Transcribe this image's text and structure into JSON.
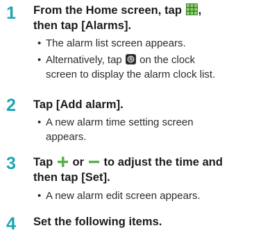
{
  "steps": [
    {
      "number": "1",
      "title_part1": "From the Home screen, tap",
      "title_part2": ",",
      "title_line2": "then tap [Alarms].",
      "title_icon": "app-grid-icon",
      "bullets": [
        {
          "dot": "•",
          "text": "The alarm list screen appears."
        },
        {
          "dot": "•",
          "text_part1": "Alternatively, tap",
          "text_part2": "on the clock",
          "text_line2": "screen to display the alarm clock list.",
          "icon": "alarm-clock-icon"
        }
      ]
    },
    {
      "number": "2",
      "title": "Tap [Add alarm].",
      "bullets": [
        {
          "dot": "•",
          "text_line1": "A new alarm time setting screen",
          "text_line2": "appears."
        }
      ]
    },
    {
      "number": "3",
      "title_part1": "Tap",
      "title_part2": "or",
      "title_part3": "to adjust the time and",
      "title_line2": "then tap [Set].",
      "icons": [
        "plus-icon",
        "minus-icon"
      ],
      "bullets": [
        {
          "dot": "•",
          "text": "A new alarm edit screen appears."
        }
      ]
    },
    {
      "number": "4",
      "title": "Set the following items."
    }
  ],
  "colors": {
    "step_number": "#1aa6b7",
    "icon_green": "#5fae4e",
    "text": "#1a1a1a"
  }
}
